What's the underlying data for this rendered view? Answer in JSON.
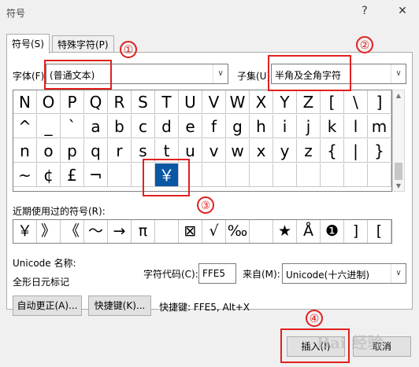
{
  "window": {
    "title": "符号",
    "help_icon": "?",
    "close_icon": "✕"
  },
  "tabs": [
    {
      "label": "符号(S)"
    },
    {
      "label": "特殊字符(P)"
    }
  ],
  "font": {
    "label": "字体(F):",
    "value": "(普通文本)"
  },
  "subset": {
    "label": "子集(U):",
    "value": "半角及全角字符"
  },
  "symbol_rows": [
    [
      "N",
      "O",
      "P",
      "Q",
      "R",
      "S",
      "T",
      "U",
      "V",
      "W",
      "X",
      "Y",
      "Z",
      "[",
      "\\",
      "]"
    ],
    [
      "^",
      "_",
      "`",
      "a",
      "b",
      "c",
      "d",
      "e",
      "f",
      "g",
      "h",
      "i",
      "j",
      "k",
      "l",
      "m"
    ],
    [
      "n",
      "o",
      "p",
      "q",
      "r",
      "s",
      "t",
      "u",
      "v",
      "w",
      "x",
      "y",
      "z",
      "{",
      "|",
      "}"
    ],
    [
      "~",
      "¢",
      "£",
      "¬",
      "",
      "",
      "￥",
      "",
      "",
      "",
      "",
      "",
      "",
      "",
      "",
      ""
    ]
  ],
  "selected_symbol": "￥",
  "recent": {
    "label": "近期使用过的符号(R):",
    "symbols": [
      "￥",
      "》",
      "《",
      "～",
      "→",
      "π",
      "",
      "⊠",
      "√",
      "‰",
      "",
      "★",
      "Å",
      "❶",
      "]",
      "["
    ]
  },
  "unicode": {
    "name_label": "Unicode 名称:",
    "name_value": "全形日元标记"
  },
  "char_code": {
    "label": "字符代码(C):",
    "value": "FFE5"
  },
  "from": {
    "label": "来自(M):",
    "value": "Unicode(十六进制)"
  },
  "buttons": {
    "autocorrect": "自动更正(A)...",
    "shortcut_key": "快捷键(K)...",
    "insert": "插入(I)",
    "cancel": "取消"
  },
  "shortcut_text": "快捷键: FFE5, Alt+X",
  "annotations": [
    "①",
    "②",
    "③",
    "④"
  ],
  "watermark": "Bai 经验"
}
